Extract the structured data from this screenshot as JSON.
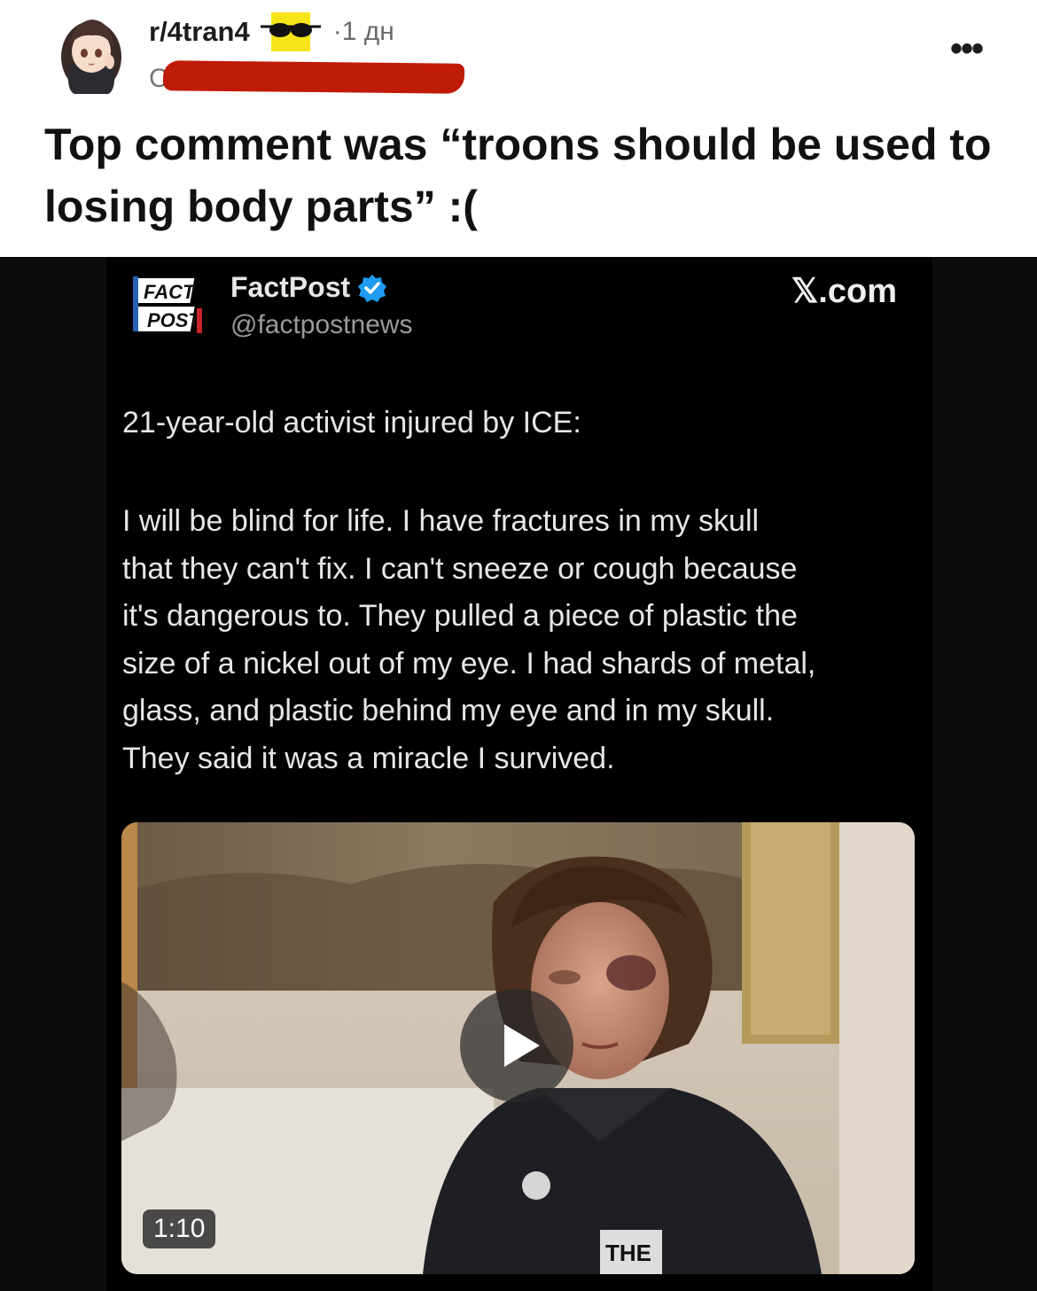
{
  "post": {
    "subreddit": "r/4tran4",
    "time": "·1 дн",
    "username_partial": "C",
    "title": "Top comment was “troons should be used to losing body parts” :("
  },
  "icons": {
    "avatar": "anime-girl-avatar",
    "badge": "sunglasses-emoji-icon",
    "more": "more-options-icon",
    "verified": "verified-badge-icon",
    "play": "play-icon"
  },
  "tweet": {
    "logo_text_line1": "FACT",
    "logo_text_line2": "POST",
    "account_name": "FactPost",
    "handle": "@factpostnews",
    "source": "𝕏.com",
    "lead": "21-year-old activist injured by ICE:",
    "body_lines": [
      "I will be blind for life. I have fractures in my skull",
      "that they can't fix. I can't sneeze or cough because",
      "it's dangerous to. They pulled a piece of plastic the",
      "size of a nickel out of my eye. I had shards of metal,",
      "glass, and plastic behind my eye and in my skull.",
      "They said it was a miracle I survived."
    ],
    "video_duration": "1:10",
    "jacket_text": "THE"
  },
  "colors": {
    "redaction": "#c01a08",
    "verified": "#1d9bf0",
    "background_dark": "#000000",
    "emoji_yellow": "#f7e51a"
  }
}
